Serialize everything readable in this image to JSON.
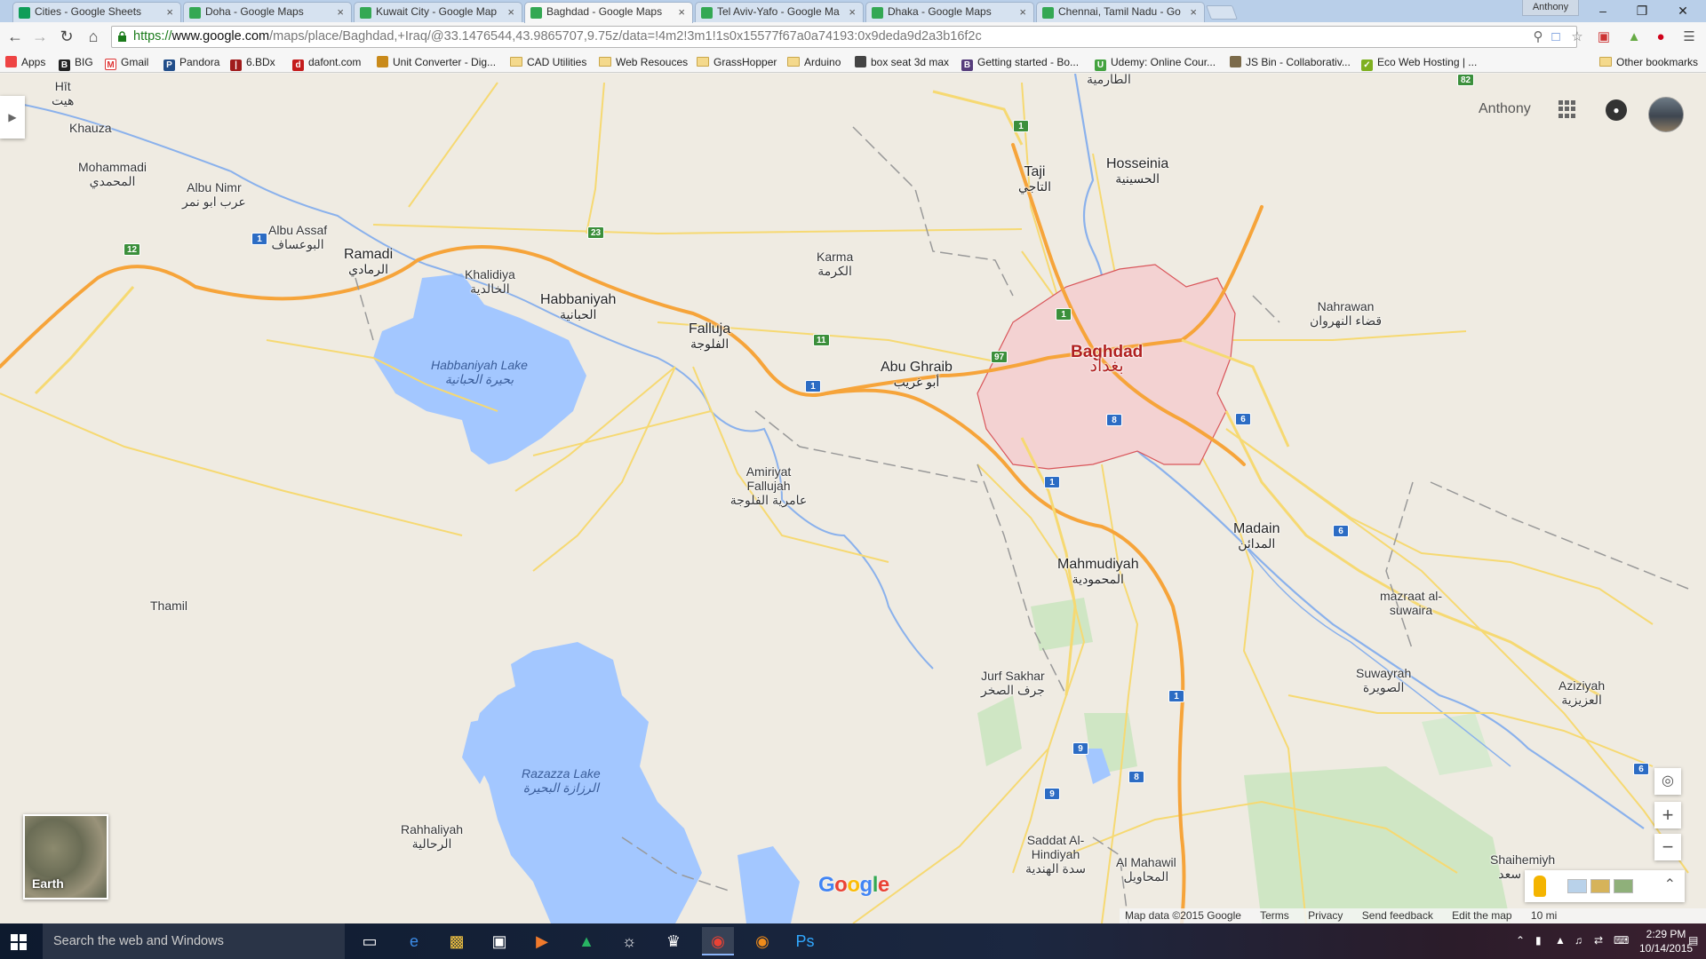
{
  "browser": {
    "tabs": [
      {
        "label": "Cities - Google Sheets",
        "icon": "sheets-icon",
        "color": "#0f9d58"
      },
      {
        "label": "Doha - Google Maps",
        "icon": "maps-icon",
        "color": "#34a853"
      },
      {
        "label": "Kuwait City - Google Map",
        "icon": "maps-icon",
        "color": "#34a853"
      },
      {
        "label": "Baghdad - Google Maps",
        "icon": "maps-icon",
        "color": "#34a853",
        "active": true
      },
      {
        "label": "Tel Aviv-Yafo - Google Ma",
        "icon": "maps-icon",
        "color": "#34a853"
      },
      {
        "label": "Dhaka - Google Maps",
        "icon": "maps-icon",
        "color": "#34a853"
      },
      {
        "label": "Chennai, Tamil Nadu - Go",
        "icon": "maps-icon",
        "color": "#34a853"
      }
    ],
    "tab_close": "×",
    "profile": "Anthony",
    "window_controls": {
      "minimize": "–",
      "maximize": "❐",
      "close": "✕"
    },
    "url_scheme": "https://",
    "url_host": "www.google.com",
    "url_rest": "/maps/place/Baghdad,+Iraq/@33.1476544,43.9865707,9.75z/data=!4m2!3m1!1s0x15577f67a0a74193:0x9deda9d2a3b16f2c",
    "bookmarks": [
      {
        "label": "Apps",
        "icon": "apps-icon"
      },
      {
        "label": "BIG",
        "icon": "big-icon"
      },
      {
        "label": "Gmail",
        "icon": "gmail-icon"
      },
      {
        "label": "Pandora",
        "icon": "pandora-icon"
      },
      {
        "label": "6.BDx",
        "icon": "bdx-icon"
      },
      {
        "label": "dafont.com",
        "icon": "dafont-icon"
      },
      {
        "label": "Unit Converter - Dig...",
        "icon": "converter-icon"
      },
      {
        "label": "CAD Utilities",
        "icon": "folder-icon"
      },
      {
        "label": "Web Resouces",
        "icon": "folder-icon"
      },
      {
        "label": "GrassHopper",
        "icon": "folder-icon"
      },
      {
        "label": "Arduino",
        "icon": "folder-icon"
      },
      {
        "label": "box seat 3d max",
        "icon": "boxseat-icon"
      },
      {
        "label": "Getting started - Bo...",
        "icon": "bootstrap-icon"
      },
      {
        "label": "Udemy: Online Cour...",
        "icon": "udemy-icon"
      },
      {
        "label": "JS Bin - Collaborativ...",
        "icon": "jsbin-icon"
      },
      {
        "label": "Eco Web Hosting | ...",
        "icon": "eco-icon"
      }
    ],
    "other_bookmarks": "Other bookmarks"
  },
  "map": {
    "account_name": "Anthony",
    "earth_label": "Earth",
    "google_logo": "Google",
    "footer": {
      "map_data": "Map data ©2015 Google",
      "terms": "Terms",
      "privacy": "Privacy",
      "feedback": "Send feedback",
      "edit": "Edit the map",
      "scale": "10 mi"
    },
    "zoom_in": "+",
    "zoom_out": "−",
    "places": {
      "hit": {
        "en": "Hīt",
        "ar": "هيت"
      },
      "khauza": {
        "en": "Khauza",
        "ar": ""
      },
      "mohammadi": {
        "en": "Mohammadi",
        "ar": "المحمدي"
      },
      "albu_nimr": {
        "en": "Albu Nimr",
        "ar": "عرب ابو نمر"
      },
      "albu_assaf": {
        "en": "Albu Assaf",
        "ar": "البوعساف"
      },
      "ramadi": {
        "en": "Ramadi",
        "ar": "الرمادي"
      },
      "khalidiya": {
        "en": "Khalidiya",
        "ar": "الخالدية"
      },
      "habbaniyah": {
        "en": "Habbaniyah",
        "ar": "الحبانية"
      },
      "falluja": {
        "en": "Falluja",
        "ar": "الفلوجة"
      },
      "karma": {
        "en": "Karma",
        "ar": "الكرمة"
      },
      "taji": {
        "en": "Taji",
        "ar": "التاجي"
      },
      "hosseinia": {
        "en": "Hosseinia",
        "ar": "الحسينية"
      },
      "tarmiya": {
        "en": "",
        "ar": "الطارمية"
      },
      "baghdad": {
        "en": "Baghdad",
        "ar": "بغداد"
      },
      "abu_ghraib": {
        "en": "Abu Ghraib",
        "ar": "أبو غريب"
      },
      "nahrawan": {
        "en": "Nahrawan",
        "ar": "قضاء النهروان"
      },
      "amiriyat": {
        "en": "Amiriyat Fallujah",
        "ar": "عامرية الفلوجة"
      },
      "madain": {
        "en": "Madain",
        "ar": "المدائن"
      },
      "mahmudiyah": {
        "en": "Mahmudiyah",
        "ar": "المحمودية"
      },
      "mazraat": {
        "en": "mazraat al-suwaira",
        "ar": ""
      },
      "thamil": {
        "en": "Thamil",
        "ar": ""
      },
      "jurf_sakhar": {
        "en": "Jurf Sakhar",
        "ar": "جرف الصخر"
      },
      "suwayrah": {
        "en": "Suwayrah",
        "ar": "الصويرة"
      },
      "aziziyah": {
        "en": "Aziziyah",
        "ar": "العزيزية"
      },
      "rahhaliyah": {
        "en": "Rahhaliyah",
        "ar": "الرحالية"
      },
      "saddat": {
        "en": "Saddat Al-Hindiyah",
        "ar": "سدة الهندية"
      },
      "al_mahawil": {
        "en": "Al Mahawil",
        "ar": "المحاويل"
      },
      "shaihemiyh": {
        "en": "Shaihemiyh",
        "ar": "شيخ سعد"
      },
      "habbaniyah_lake": {
        "en": "Habbaniyah Lake",
        "ar": "بحيرة الحبانية"
      },
      "razazza_lake": {
        "en": "Razazza Lake",
        "ar": "الرزازة البحيرة"
      }
    },
    "shields": [
      "1",
      "1",
      "1",
      "1",
      "1",
      "12",
      "23",
      "11",
      "97",
      "1",
      "6",
      "6",
      "6",
      "8",
      "8",
      "8",
      "9",
      "9",
      "82"
    ]
  },
  "taskbar": {
    "search_placeholder": "Search the web and Windows",
    "time": "2:29 PM",
    "date": "10/14/2015"
  },
  "colors": {
    "land": "#efebe2",
    "water": "#a3c7ff",
    "highway": "#f6a43a",
    "road": "#f6d972",
    "baghdad_fill": "#f3d2d2",
    "baghdad_border": "#d9555a",
    "parks": "#cfe6c4"
  }
}
